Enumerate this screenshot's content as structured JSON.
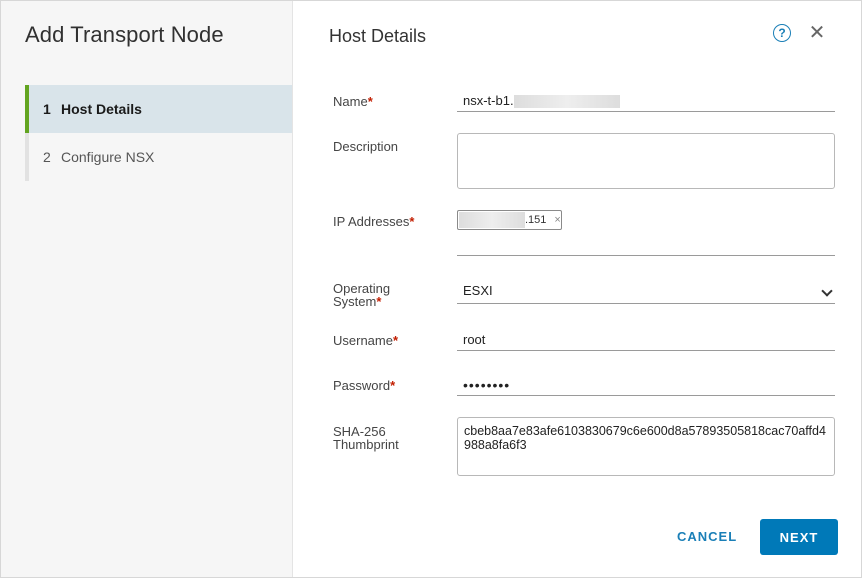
{
  "wizard": {
    "title": "Add Transport Node"
  },
  "steps": [
    {
      "number": "1",
      "label": "Host Details"
    },
    {
      "number": "2",
      "label": "Configure NSX"
    }
  ],
  "page": {
    "title": "Host Details",
    "help_glyph": "?",
    "close_glyph": "✕"
  },
  "form": {
    "name": {
      "label": "Name",
      "value": "nsx-t-b1."
    },
    "description": {
      "label": "Description",
      "value": ""
    },
    "ip": {
      "label": "IP Addresses",
      "chip_value": ".151",
      "chip_remove": "×"
    },
    "os": {
      "label_line1": "Operating",
      "label_line2": "System",
      "value": "ESXI"
    },
    "username": {
      "label": "Username",
      "value": "root"
    },
    "password": {
      "label": "Password",
      "value": "••••••••"
    },
    "thumbprint": {
      "label_line1": "SHA-256",
      "label_line2": "Thumbprint",
      "value": "cbeb8aa7e83afe6103830679c6e600d8a57893505818cac70affd4988a8fa6f3"
    },
    "required_mark": "*"
  },
  "actions": {
    "cancel": "CANCEL",
    "next": "NEXT"
  },
  "colors": {
    "accent": "#0079b8",
    "active_step_bar": "#62a420",
    "required": "#c21d00"
  }
}
